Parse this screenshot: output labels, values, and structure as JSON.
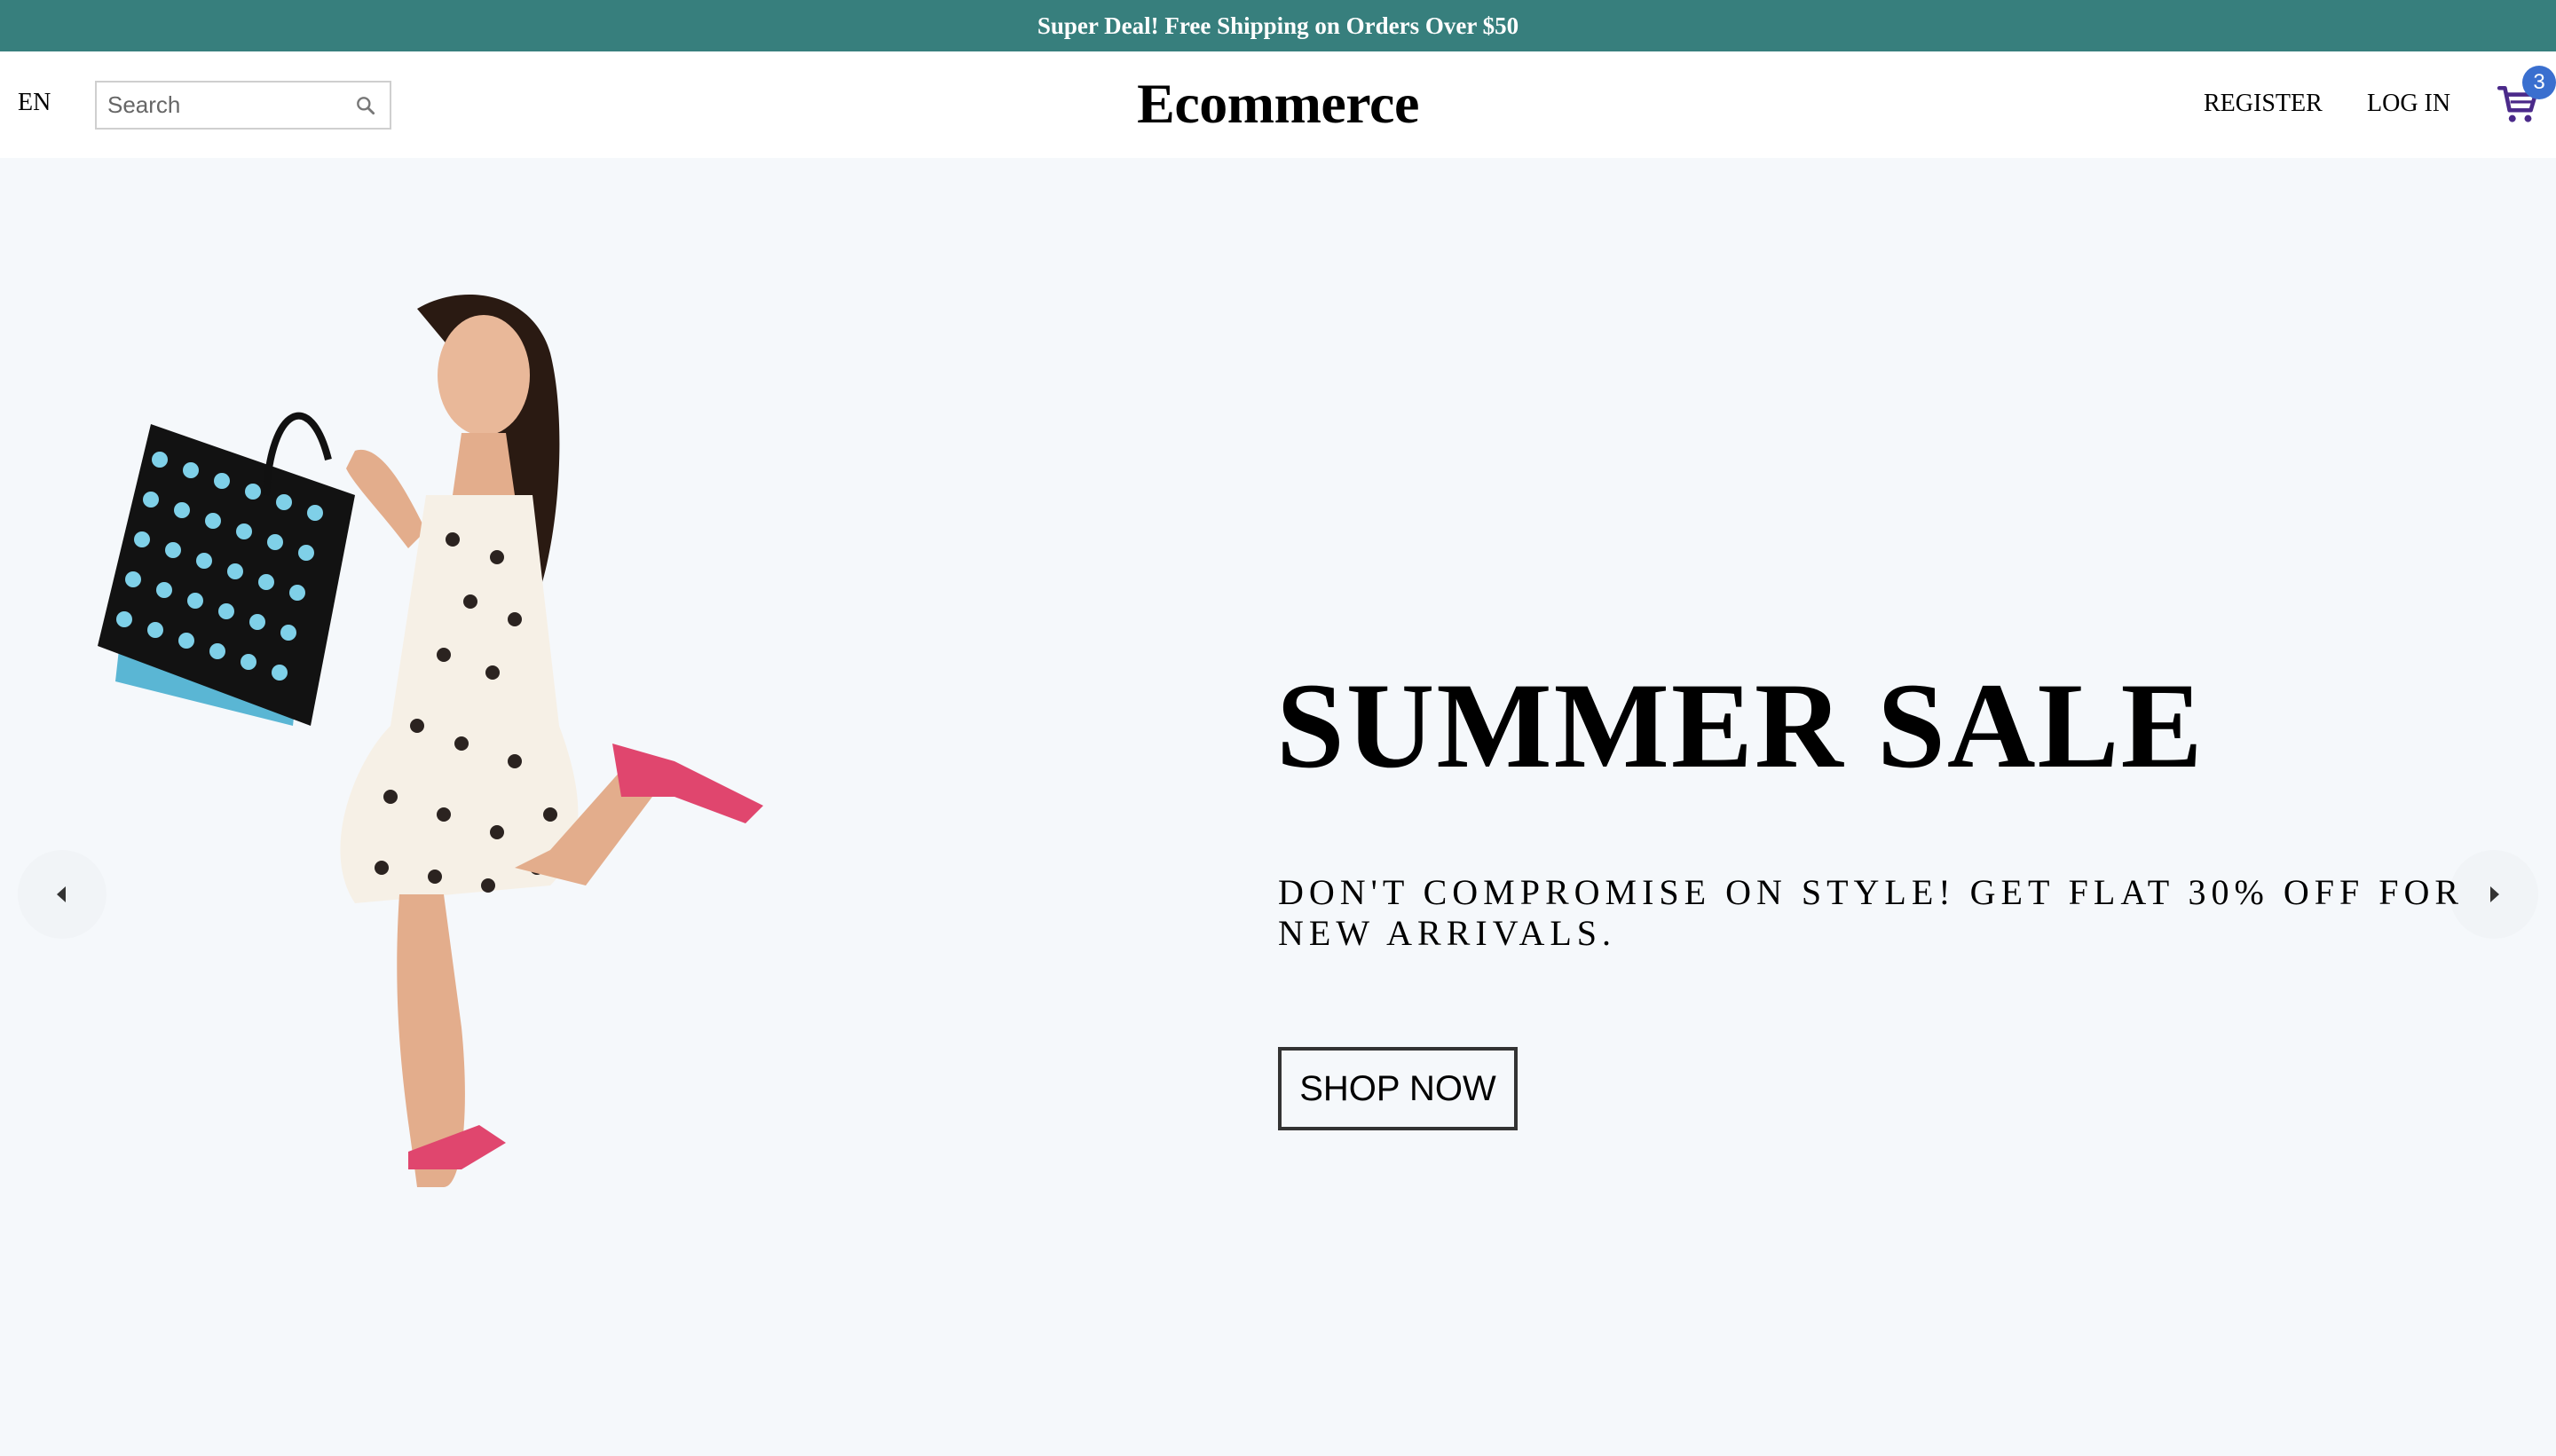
{
  "announcement": {
    "text": "Super Deal! Free Shipping on Orders Over $50"
  },
  "navbar": {
    "language": "EN",
    "search": {
      "placeholder": "Search",
      "value": ""
    },
    "logo": "Ecommerce",
    "register_label": "REGISTER",
    "login_label": "LOG IN",
    "cart": {
      "icon": "cart-icon",
      "count": "3"
    }
  },
  "hero": {
    "title": "SUMMER SALE",
    "description": "DON'T COMPROMISE ON STYLE! GET FLAT 30% OFF FOR NEW ARRIVALS.",
    "cta_label": "SHOP NOW",
    "image": "woman-with-shopping-bags"
  },
  "colors": {
    "announcement_bg": "#377f7d",
    "page_bg": "#f5f8fb",
    "badge_bg": "#3a6fcf",
    "cart_icon": "#4b2a8a",
    "accent_pink": "#e0466e"
  }
}
